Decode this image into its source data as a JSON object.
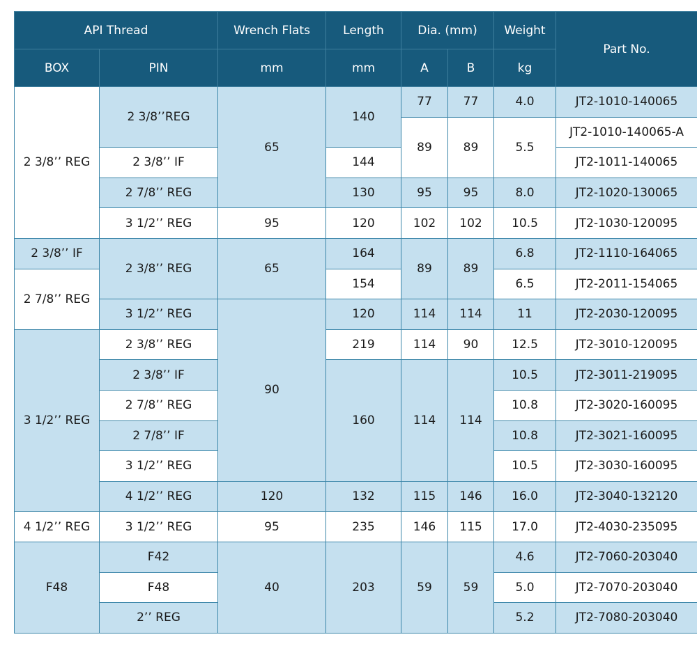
{
  "header": {
    "api_thread": "API Thread",
    "wrench_flats": "Wrench Flats",
    "length": "Length",
    "dia": "Dia. (mm)",
    "weight": "Weight",
    "part_no": "Part No.",
    "box": "BOX",
    "pin": "PIN",
    "wrench_unit": "mm",
    "length_unit": "mm",
    "dia_a": "A",
    "dia_b": "B",
    "weight_unit": "kg"
  },
  "rows": [
    {
      "box": "2 3/8’’ REG",
      "pin": "2 3/8’’REG",
      "wrench": "65",
      "length": "140",
      "a": "77",
      "b": "77",
      "weight": "4.0",
      "part": "JT2-1010-140065"
    },
    {
      "a": "89",
      "b": "89",
      "weight": "5.5",
      "part": "JT2-1010-140065-A"
    },
    {
      "pin": "2 3/8’’ IF",
      "length": "144",
      "part": "JT2-1011-140065"
    },
    {
      "pin": "2 7/8’’ REG",
      "length": "130",
      "a": "95",
      "b": "95",
      "weight": "8.0",
      "part": "JT2-1020-130065"
    },
    {
      "pin": "3 1/2’’ REG",
      "wrench": "95",
      "length": "120",
      "a": "102",
      "b": "102",
      "weight": "10.5",
      "part": "JT2-1030-120095"
    },
    {
      "box": "2 3/8’’ IF",
      "pin": "2 3/8’’ REG",
      "wrench": "65",
      "length": "164",
      "a": "89",
      "b": "89",
      "weight": "6.8",
      "part": "JT2-1110-164065"
    },
    {
      "box": "2 7/8’’ REG",
      "length": "154",
      "weight": "6.5",
      "part": "JT2-2011-154065"
    },
    {
      "pin": "3 1/2’’ REG",
      "wrench": "90",
      "length": "120",
      "a": "114",
      "b": "114",
      "weight": "11",
      "part": "JT2-2030-120095"
    },
    {
      "box": "3 1/2’’ REG",
      "pin": "2 3/8’’ REG",
      "length": "219",
      "a": "114",
      "b": "90",
      "weight": "12.5",
      "part": "JT2-3010-120095"
    },
    {
      "pin": "2 3/8’’ IF",
      "length": "160",
      "a": "114",
      "b": "114",
      "weight": "10.5",
      "part": "JT2-3011-219095"
    },
    {
      "pin": "2 7/8’’ REG",
      "weight": "10.8",
      "part": "JT2-3020-160095"
    },
    {
      "pin": "2 7/8’’ IF",
      "weight": "10.8",
      "part": "JT2-3021-160095"
    },
    {
      "pin": "3 1/2’’ REG",
      "weight": "10.5",
      "part": "JT2-3030-160095"
    },
    {
      "pin": "4 1/2’’ REG",
      "wrench": "120",
      "length": "132",
      "a": "115",
      "b": "146",
      "weight": "16.0",
      "part": "JT2-3040-132120"
    },
    {
      "box": "4 1/2’’ REG",
      "pin": "3 1/2’’ REG",
      "wrench": "95",
      "length": "235",
      "a": "146",
      "b": "115",
      "weight": "17.0",
      "part": "JT2-4030-235095"
    },
    {
      "box": "F48",
      "pin": "F42",
      "wrench": "40",
      "length": "203",
      "a": "59",
      "b": "59",
      "weight": "4.6",
      "part": "JT2-7060-203040"
    },
    {
      "pin": "F48",
      "weight": "5.0",
      "part": "JT2-7070-203040"
    },
    {
      "pin": "2’’ REG",
      "weight": "5.2",
      "part": "JT2-7080-203040"
    }
  ]
}
